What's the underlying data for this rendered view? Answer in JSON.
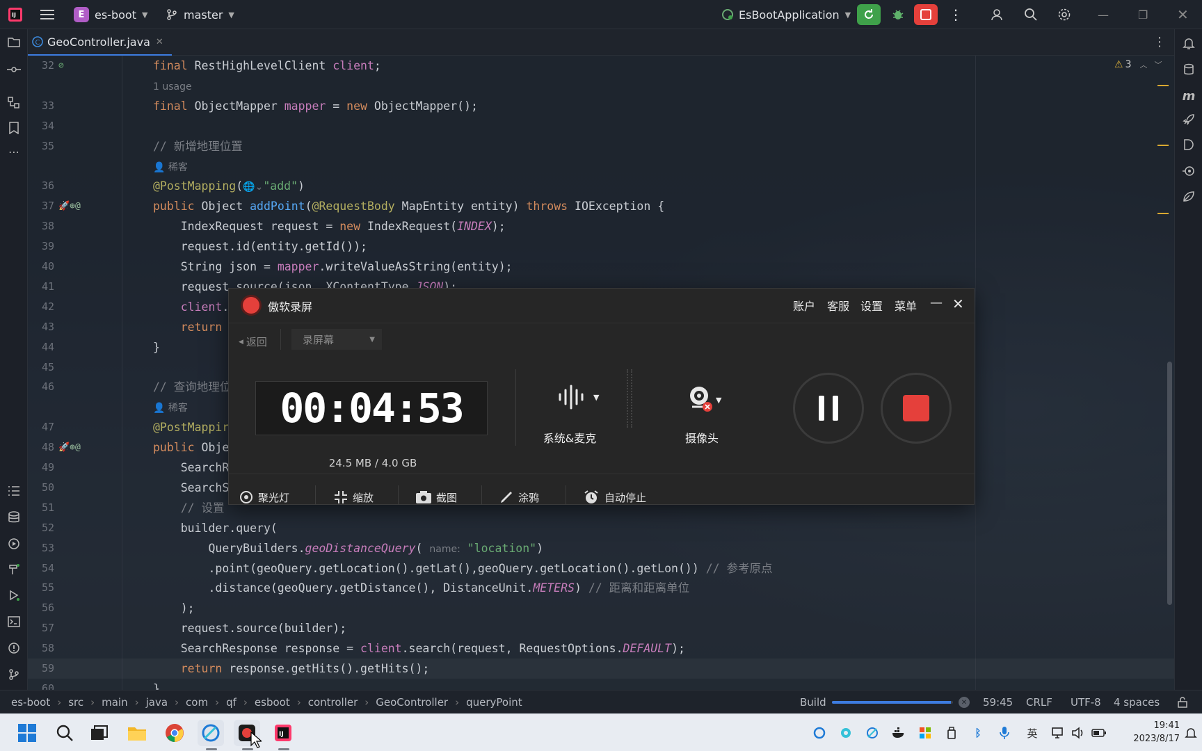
{
  "topbar": {
    "project_badge": "E",
    "project": "es-boot",
    "branch": "master",
    "run_config": "EsBootApplication"
  },
  "tab": {
    "label": "GeoController.java"
  },
  "editor": {
    "warnings": "3",
    "lines": [
      {
        "n": "32",
        "code": [
          [
            "kw",
            "final "
          ],
          [
            "",
            "RestHighLevelClient "
          ],
          [
            "fld",
            "client"
          ],
          [
            "",
            ";"
          ]
        ]
      },
      {
        "n": "",
        "hint": "1 usage"
      },
      {
        "n": "33",
        "code": [
          [
            "kw",
            "final "
          ],
          [
            "",
            "ObjectMapper "
          ],
          [
            "fld",
            "mapper"
          ],
          [
            "",
            " = "
          ],
          [
            "kw",
            "new "
          ],
          [
            "",
            "ObjectMapper();"
          ]
        ]
      },
      {
        "n": "34",
        "code": []
      },
      {
        "n": "35",
        "code": [
          [
            "cmt",
            "// 新增地理位置"
          ]
        ]
      },
      {
        "n": "",
        "hint": "👤 稀客"
      },
      {
        "n": "36",
        "code": [
          [
            "an",
            "@PostMapping"
          ],
          [
            "",
            "("
          ],
          [
            "hint",
            "🌐⌄"
          ],
          [
            "str",
            "\"add\""
          ],
          [
            "",
            ")"
          ]
        ]
      },
      {
        "n": "37",
        "code": [
          [
            "kw",
            "public "
          ],
          [
            "",
            "Object "
          ],
          [
            "fn",
            "addPoint"
          ],
          [
            "",
            "("
          ],
          [
            "an",
            "@RequestBody "
          ],
          [
            "",
            "MapEntity entity) "
          ],
          [
            "kw",
            "throws "
          ],
          [
            "",
            "IOException {"
          ]
        ]
      },
      {
        "n": "38",
        "code": [
          [
            "",
            "    IndexRequest request = "
          ],
          [
            "kw",
            "new "
          ],
          [
            "",
            "IndexRequest("
          ],
          [
            "cst",
            "INDEX"
          ],
          [
            "",
            ");"
          ]
        ]
      },
      {
        "n": "39",
        "code": [
          [
            "",
            "    request.id(entity.getId());"
          ]
        ]
      },
      {
        "n": "40",
        "code": [
          [
            "",
            "    String json = "
          ],
          [
            "fld",
            "mapper"
          ],
          [
            "",
            ".writeValueAsString(entity);"
          ]
        ]
      },
      {
        "n": "41",
        "code": [
          [
            "",
            "    request.source(json, XContentType."
          ],
          [
            "cst",
            "JSON"
          ],
          [
            "",
            ");"
          ]
        ]
      },
      {
        "n": "42",
        "code": [
          [
            "fld",
            "    client"
          ],
          [
            "",
            "."
          ]
        ]
      },
      {
        "n": "43",
        "code": [
          [
            "kw",
            "    return"
          ]
        ]
      },
      {
        "n": "44",
        "code": [
          [
            "",
            "}"
          ]
        ]
      },
      {
        "n": "45",
        "code": []
      },
      {
        "n": "46",
        "code": [
          [
            "cmt",
            "// 查询地理位"
          ]
        ]
      },
      {
        "n": "",
        "hint": "👤 稀客"
      },
      {
        "n": "47",
        "code": [
          [
            "an",
            "@PostMappir"
          ]
        ]
      },
      {
        "n": "48",
        "code": [
          [
            "kw",
            "public "
          ],
          [
            "",
            "Obje"
          ]
        ]
      },
      {
        "n": "49",
        "code": [
          [
            "",
            "    SearchR"
          ]
        ]
      },
      {
        "n": "50",
        "code": [
          [
            "",
            "    SearchS"
          ]
        ]
      },
      {
        "n": "51",
        "code": [
          [
            "cmt",
            "    // 设置"
          ]
        ]
      },
      {
        "n": "52",
        "code": [
          [
            "",
            "    builder.query("
          ]
        ]
      },
      {
        "n": "53",
        "code": [
          [
            "",
            "        QueryBuilders."
          ],
          [
            "cst",
            "geoDistanceQuery"
          ],
          [
            "",
            "( "
          ],
          [
            "hint",
            "name:"
          ],
          [
            "",
            " "
          ],
          [
            "str",
            "\"location\""
          ],
          [
            "",
            ")"
          ]
        ]
      },
      {
        "n": "54",
        "code": [
          [
            "",
            "        .point(geoQuery.getLocation().getLat(),geoQuery.getLocation().getLon()) "
          ],
          [
            "cmt",
            "// 参考原点"
          ]
        ]
      },
      {
        "n": "55",
        "code": [
          [
            "",
            "        .distance(geoQuery.getDistance(), DistanceUnit."
          ],
          [
            "cst",
            "METERS"
          ],
          [
            "",
            ") "
          ],
          [
            "cmt",
            "// 距离和距离单位"
          ]
        ]
      },
      {
        "n": "56",
        "code": [
          [
            "",
            "    );"
          ]
        ]
      },
      {
        "n": "57",
        "code": [
          [
            "",
            "    request.source(builder);"
          ]
        ]
      },
      {
        "n": "58",
        "code": [
          [
            "",
            "    SearchResponse response = "
          ],
          [
            "fld",
            "client"
          ],
          [
            "",
            ".search(request, RequestOptions."
          ],
          [
            "cst",
            "DEFAULT"
          ],
          [
            "",
            ");"
          ]
        ]
      },
      {
        "n": "59",
        "code": [
          [
            "kw",
            "    return "
          ],
          [
            "",
            "response.getHits().getHits();"
          ]
        ]
      },
      {
        "n": "60",
        "code": [
          [
            "",
            "}"
          ]
        ]
      }
    ]
  },
  "recorder": {
    "title": "傲软录屏",
    "menu": [
      "账户",
      "客服",
      "设置",
      "菜单"
    ],
    "back": "返回",
    "mode": "录屏幕",
    "timer": "00:04:53",
    "storage": "24.5 MB / 4.0 GB",
    "audio_label": "系统&麦克",
    "camera_label": "摄像头",
    "tools": [
      "聚光灯",
      "缩放",
      "截图",
      "涂鸦",
      "自动停止"
    ]
  },
  "status": {
    "breadcrumb": [
      "es-boot",
      "src",
      "main",
      "java",
      "com",
      "qf",
      "esboot",
      "controller",
      "GeoController",
      "queryPoint"
    ],
    "build_label": "Build",
    "build_progress": 0.98,
    "position": "59:45",
    "line_sep": "CRLF",
    "encoding": "UTF-8",
    "indent": "4 spaces"
  },
  "taskbar": {
    "ime": "英",
    "time": "19:41",
    "date": "2023/8/17"
  },
  "colors": {
    "accent": "#3d7ce0",
    "run_green": "#3fa14a",
    "stop_red": "#e5403b",
    "keyword": "#d38b5d",
    "annotation": "#b3ae60",
    "string": "#6aab73",
    "field": "#c77dbb"
  }
}
